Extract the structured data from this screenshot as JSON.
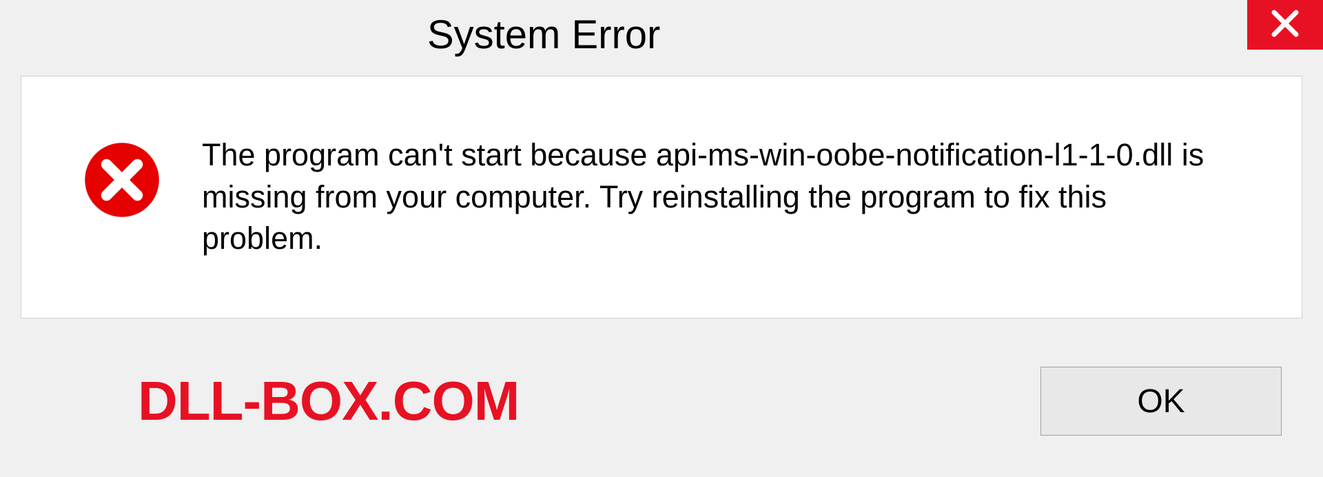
{
  "dialog": {
    "title": "System Error",
    "message": "The program can't start because api-ms-win-oobe-notification-l1-1-0.dll is missing from your computer. Try reinstalling the program to fix this problem.",
    "ok_label": "OK"
  },
  "brand": "DLL-BOX.COM",
  "colors": {
    "error_red": "#e81123",
    "background": "#f0f0f0"
  }
}
